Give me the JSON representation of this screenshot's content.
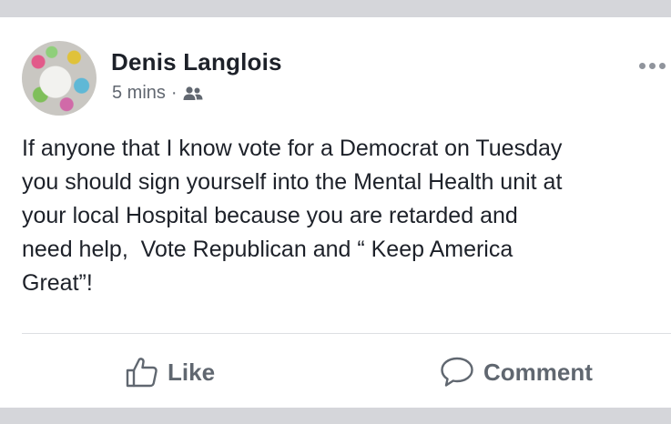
{
  "post": {
    "author": "Denis Langlois",
    "time": "5 mins",
    "separator": "·",
    "audience_icon": "friends-icon",
    "more_icon": "more-options-icon",
    "text": "If anyone that I know vote for a Democrat on Tuesday\nyou should sign yourself into the Mental Health unit at\nyour local Hospital because you are retarded and\nneed help,  Vote Republican and “ Keep America\nGreat”!"
  },
  "actions": {
    "like_label": "Like",
    "like_icon": "thumbs-up-icon",
    "comment_label": "Comment",
    "comment_icon": "speech-bubble-icon"
  },
  "colors": {
    "band": "#d5d6da",
    "text": "#1d2129",
    "meta": "#616770",
    "action": "#606770"
  }
}
